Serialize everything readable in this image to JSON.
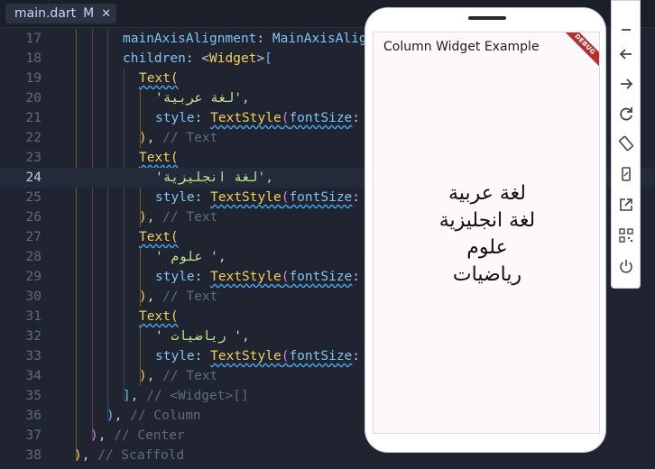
{
  "tab": {
    "label": "main.dart",
    "status": "M"
  },
  "code_lines": [
    {
      "n": "17",
      "segs": [
        [
          "k",
          "mainAxisAlignment"
        ],
        [
          "p",
          ": "
        ],
        [
          "k",
          "MainAxisAlig"
        ]
      ]
    },
    {
      "n": "18",
      "segs": [
        [
          "k",
          "children"
        ],
        [
          "p",
          ": "
        ],
        [
          "p",
          "<"
        ],
        [
          "t",
          "Widget"
        ],
        [
          "p",
          ">"
        ],
        [
          "b3",
          "["
        ]
      ]
    },
    {
      "n": "19",
      "segs": [
        [
          "t u",
          "Text"
        ],
        [
          "b1 u",
          "("
        ]
      ]
    },
    {
      "n": "20",
      "segs": [
        [
          "s",
          "'لغة عربية'"
        ],
        [
          "p",
          ","
        ]
      ]
    },
    {
      "n": "21",
      "segs": [
        [
          "k",
          "style"
        ],
        [
          "p",
          ": "
        ],
        [
          "t u",
          "TextStyle"
        ],
        [
          "b2 u",
          "("
        ],
        [
          "k u",
          "fontSize"
        ],
        [
          "p",
          ": "
        ]
      ]
    },
    {
      "n": "22",
      "segs": [
        [
          "b1",
          ")"
        ],
        [
          "p",
          ", "
        ],
        [
          "c",
          "// Text"
        ]
      ]
    },
    {
      "n": "23",
      "segs": [
        [
          "t u",
          "Text"
        ],
        [
          "b1 u",
          "("
        ]
      ]
    },
    {
      "n": "24",
      "segs": [
        [
          "s",
          "'لغة انجليزية'"
        ],
        [
          "p",
          ","
        ]
      ]
    },
    {
      "n": "25",
      "segs": [
        [
          "k",
          "style"
        ],
        [
          "p",
          ": "
        ],
        [
          "t u",
          "TextStyle"
        ],
        [
          "b2 u",
          "("
        ],
        [
          "k u",
          "fontSize"
        ],
        [
          "p",
          ": "
        ]
      ]
    },
    {
      "n": "26",
      "segs": [
        [
          "b1",
          ")"
        ],
        [
          "p",
          ", "
        ],
        [
          "c",
          "// Text"
        ]
      ]
    },
    {
      "n": "27",
      "segs": [
        [
          "t u",
          "Text"
        ],
        [
          "b1 u",
          "("
        ]
      ]
    },
    {
      "n": "28",
      "segs": [
        [
          "s",
          "' علوم '"
        ],
        [
          "p",
          ","
        ]
      ]
    },
    {
      "n": "29",
      "segs": [
        [
          "k",
          "style"
        ],
        [
          "p",
          ": "
        ],
        [
          "t u",
          "TextStyle"
        ],
        [
          "b2 u",
          "("
        ],
        [
          "k u",
          "fontSize"
        ],
        [
          "p",
          ": "
        ]
      ]
    },
    {
      "n": "30",
      "segs": [
        [
          "b1",
          ")"
        ],
        [
          "p",
          ", "
        ],
        [
          "c",
          "// Text"
        ]
      ]
    },
    {
      "n": "31",
      "segs": [
        [
          "t u",
          "Text"
        ],
        [
          "b1 u",
          "("
        ]
      ]
    },
    {
      "n": "32",
      "segs": [
        [
          "s",
          "' رياضيات '"
        ],
        [
          "p",
          ","
        ]
      ]
    },
    {
      "n": "33",
      "segs": [
        [
          "k",
          "style"
        ],
        [
          "p",
          ": "
        ],
        [
          "t u",
          "TextStyle"
        ],
        [
          "b2 u",
          "("
        ],
        [
          "k u",
          "fontSize"
        ],
        [
          "p",
          ": "
        ]
      ]
    },
    {
      "n": "34",
      "segs": [
        [
          "b1",
          ")"
        ],
        [
          "p",
          ", "
        ],
        [
          "c",
          "// Text"
        ]
      ]
    },
    {
      "n": "35",
      "segs": [
        [
          "b3",
          "]"
        ],
        [
          "p",
          ", "
        ],
        [
          "c",
          "// <Widget>[]"
        ]
      ]
    },
    {
      "n": "36",
      "segs": [
        [
          "b3",
          ")"
        ],
        [
          "p",
          ", "
        ],
        [
          "c",
          "// Column"
        ]
      ]
    },
    {
      "n": "37",
      "segs": [
        [
          "b2",
          ")"
        ],
        [
          "p",
          ", "
        ],
        [
          "c",
          "// Center"
        ]
      ]
    },
    {
      "n": "38",
      "segs": [
        [
          "b1",
          ")"
        ],
        [
          "p",
          ", "
        ],
        [
          "c",
          "// Scaffold"
        ]
      ]
    }
  ],
  "active_line": "24",
  "phone": {
    "appbar_title": "Column Widget Example",
    "debug_banner": "DEBUG",
    "column_texts": [
      "لغة عربية",
      "لغة انجليزية",
      "علوم",
      "رياضيات"
    ]
  },
  "toolbar": {
    "icons": [
      "minimize-icon",
      "back-icon",
      "forward-icon",
      "rotate-icon",
      "rotate-screen-icon",
      "device-icon",
      "open-external-icon",
      "qr-code-icon",
      "power-icon"
    ]
  }
}
